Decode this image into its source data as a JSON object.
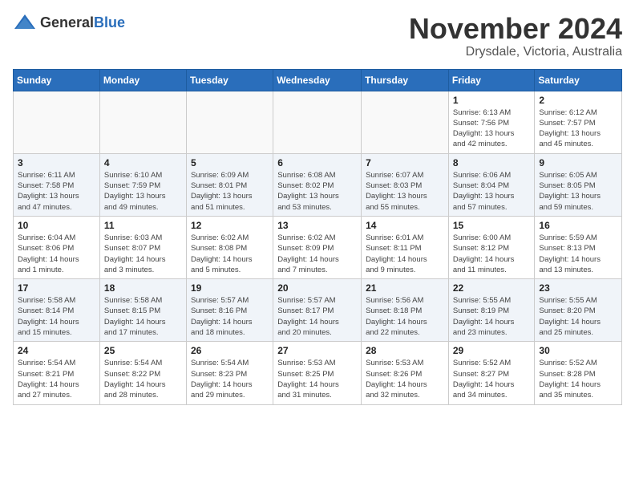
{
  "logo": {
    "text_general": "General",
    "text_blue": "Blue"
  },
  "header": {
    "month": "November 2024",
    "location": "Drysdale, Victoria, Australia"
  },
  "weekdays": [
    "Sunday",
    "Monday",
    "Tuesday",
    "Wednesday",
    "Thursday",
    "Friday",
    "Saturday"
  ],
  "weeks": [
    [
      {
        "day": "",
        "info": ""
      },
      {
        "day": "",
        "info": ""
      },
      {
        "day": "",
        "info": ""
      },
      {
        "day": "",
        "info": ""
      },
      {
        "day": "",
        "info": ""
      },
      {
        "day": "1",
        "info": "Sunrise: 6:13 AM\nSunset: 7:56 PM\nDaylight: 13 hours\nand 42 minutes."
      },
      {
        "day": "2",
        "info": "Sunrise: 6:12 AM\nSunset: 7:57 PM\nDaylight: 13 hours\nand 45 minutes."
      }
    ],
    [
      {
        "day": "3",
        "info": "Sunrise: 6:11 AM\nSunset: 7:58 PM\nDaylight: 13 hours\nand 47 minutes."
      },
      {
        "day": "4",
        "info": "Sunrise: 6:10 AM\nSunset: 7:59 PM\nDaylight: 13 hours\nand 49 minutes."
      },
      {
        "day": "5",
        "info": "Sunrise: 6:09 AM\nSunset: 8:01 PM\nDaylight: 13 hours\nand 51 minutes."
      },
      {
        "day": "6",
        "info": "Sunrise: 6:08 AM\nSunset: 8:02 PM\nDaylight: 13 hours\nand 53 minutes."
      },
      {
        "day": "7",
        "info": "Sunrise: 6:07 AM\nSunset: 8:03 PM\nDaylight: 13 hours\nand 55 minutes."
      },
      {
        "day": "8",
        "info": "Sunrise: 6:06 AM\nSunset: 8:04 PM\nDaylight: 13 hours\nand 57 minutes."
      },
      {
        "day": "9",
        "info": "Sunrise: 6:05 AM\nSunset: 8:05 PM\nDaylight: 13 hours\nand 59 minutes."
      }
    ],
    [
      {
        "day": "10",
        "info": "Sunrise: 6:04 AM\nSunset: 8:06 PM\nDaylight: 14 hours\nand 1 minute."
      },
      {
        "day": "11",
        "info": "Sunrise: 6:03 AM\nSunset: 8:07 PM\nDaylight: 14 hours\nand 3 minutes."
      },
      {
        "day": "12",
        "info": "Sunrise: 6:02 AM\nSunset: 8:08 PM\nDaylight: 14 hours\nand 5 minutes."
      },
      {
        "day": "13",
        "info": "Sunrise: 6:02 AM\nSunset: 8:09 PM\nDaylight: 14 hours\nand 7 minutes."
      },
      {
        "day": "14",
        "info": "Sunrise: 6:01 AM\nSunset: 8:11 PM\nDaylight: 14 hours\nand 9 minutes."
      },
      {
        "day": "15",
        "info": "Sunrise: 6:00 AM\nSunset: 8:12 PM\nDaylight: 14 hours\nand 11 minutes."
      },
      {
        "day": "16",
        "info": "Sunrise: 5:59 AM\nSunset: 8:13 PM\nDaylight: 14 hours\nand 13 minutes."
      }
    ],
    [
      {
        "day": "17",
        "info": "Sunrise: 5:58 AM\nSunset: 8:14 PM\nDaylight: 14 hours\nand 15 minutes."
      },
      {
        "day": "18",
        "info": "Sunrise: 5:58 AM\nSunset: 8:15 PM\nDaylight: 14 hours\nand 17 minutes."
      },
      {
        "day": "19",
        "info": "Sunrise: 5:57 AM\nSunset: 8:16 PM\nDaylight: 14 hours\nand 18 minutes."
      },
      {
        "day": "20",
        "info": "Sunrise: 5:57 AM\nSunset: 8:17 PM\nDaylight: 14 hours\nand 20 minutes."
      },
      {
        "day": "21",
        "info": "Sunrise: 5:56 AM\nSunset: 8:18 PM\nDaylight: 14 hours\nand 22 minutes."
      },
      {
        "day": "22",
        "info": "Sunrise: 5:55 AM\nSunset: 8:19 PM\nDaylight: 14 hours\nand 23 minutes."
      },
      {
        "day": "23",
        "info": "Sunrise: 5:55 AM\nSunset: 8:20 PM\nDaylight: 14 hours\nand 25 minutes."
      }
    ],
    [
      {
        "day": "24",
        "info": "Sunrise: 5:54 AM\nSunset: 8:21 PM\nDaylight: 14 hours\nand 27 minutes."
      },
      {
        "day": "25",
        "info": "Sunrise: 5:54 AM\nSunset: 8:22 PM\nDaylight: 14 hours\nand 28 minutes."
      },
      {
        "day": "26",
        "info": "Sunrise: 5:54 AM\nSunset: 8:23 PM\nDaylight: 14 hours\nand 29 minutes."
      },
      {
        "day": "27",
        "info": "Sunrise: 5:53 AM\nSunset: 8:25 PM\nDaylight: 14 hours\nand 31 minutes."
      },
      {
        "day": "28",
        "info": "Sunrise: 5:53 AM\nSunset: 8:26 PM\nDaylight: 14 hours\nand 32 minutes."
      },
      {
        "day": "29",
        "info": "Sunrise: 5:52 AM\nSunset: 8:27 PM\nDaylight: 14 hours\nand 34 minutes."
      },
      {
        "day": "30",
        "info": "Sunrise: 5:52 AM\nSunset: 8:28 PM\nDaylight: 14 hours\nand 35 minutes."
      }
    ]
  ]
}
